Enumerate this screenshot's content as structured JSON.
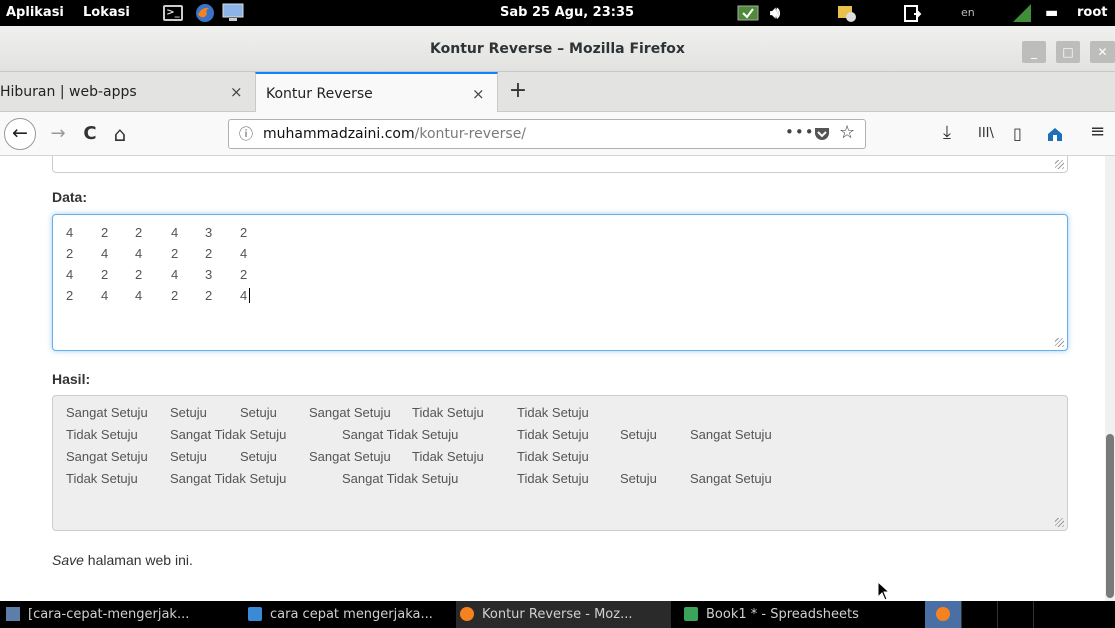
{
  "panel": {
    "apps_label": "Aplikasi",
    "places_label": "Lokasi",
    "clock": "Sab 25 Agu, 23:35",
    "keyboard_layout": "en",
    "user": "root",
    "terminal_glyph": ">_"
  },
  "window": {
    "title": "Kontur Reverse – Mozilla Firefox",
    "minimize_label": "_",
    "maximize_label": "□",
    "close_label": "✕"
  },
  "tabs": [
    {
      "label": "Hiburan | web-apps",
      "close": "×"
    },
    {
      "label": "Kontur Reverse",
      "close": "×"
    }
  ],
  "new_tab_label": "+",
  "nav": {
    "back_label": "←",
    "forward_label": "→",
    "reload_label": "C",
    "home_label": "⌂",
    "info_label": "ⓘ",
    "url_domain": "muhammadzaini.com",
    "url_path": "/kontur-reverse/",
    "page_actions_label": "•••",
    "bookmark_label": "☆",
    "downloads_label": "⤓",
    "library_label": "III\\",
    "sidebar_label": "▯"
  },
  "page": {
    "data_label": "Data:",
    "data_rows": [
      [
        "4",
        "2",
        "2",
        "4",
        "3",
        "2"
      ],
      [
        "2",
        "4",
        "4",
        "2",
        "2",
        "4"
      ],
      [
        "4",
        "2",
        "2",
        "4",
        "3",
        "2"
      ],
      [
        "2",
        "4",
        "4",
        "2",
        "2",
        "4"
      ]
    ],
    "hasil_label": "Hasil:",
    "hasil_rows": [
      [
        "Sangat Setuju",
        "Setuju",
        "Setuju",
        "Sangat Setuju",
        "Tidak Setuju",
        "Tidak Setuju"
      ],
      [
        "Tidak Setuju",
        "Sangat Tidak Setuju",
        "Sangat Tidak Setuju",
        "Tidak Setuju",
        "Setuju",
        "Sangat Setuju"
      ],
      [
        "Sangat Setuju",
        "Setuju",
        "Setuju",
        "Sangat Setuju",
        "Tidak Setuju",
        "Tidak Setuju"
      ],
      [
        "Tidak Setuju",
        "Sangat Tidak Setuju",
        "Sangat Tidak Setuju",
        "Tidak Setuju",
        "Setuju",
        "Sangat Setuju"
      ]
    ],
    "save_em": "Save",
    "save_rest": " halaman web ini."
  },
  "taskbar": [
    {
      "label": "[cara-cepat-mengerjak...",
      "icon": "folder-icon"
    },
    {
      "label": "cara cepat mengerjaka...",
      "icon": "writer-icon"
    },
    {
      "label": "Kontur Reverse - Moz...",
      "icon": "firefox-icon"
    },
    {
      "label": "Book1 * - Spreadsheets",
      "icon": "spreadsheet-icon"
    }
  ],
  "colors": {
    "focus_border": "#66afe9",
    "tab_accent": "#0a84ff",
    "panel_bg": "#000000"
  }
}
